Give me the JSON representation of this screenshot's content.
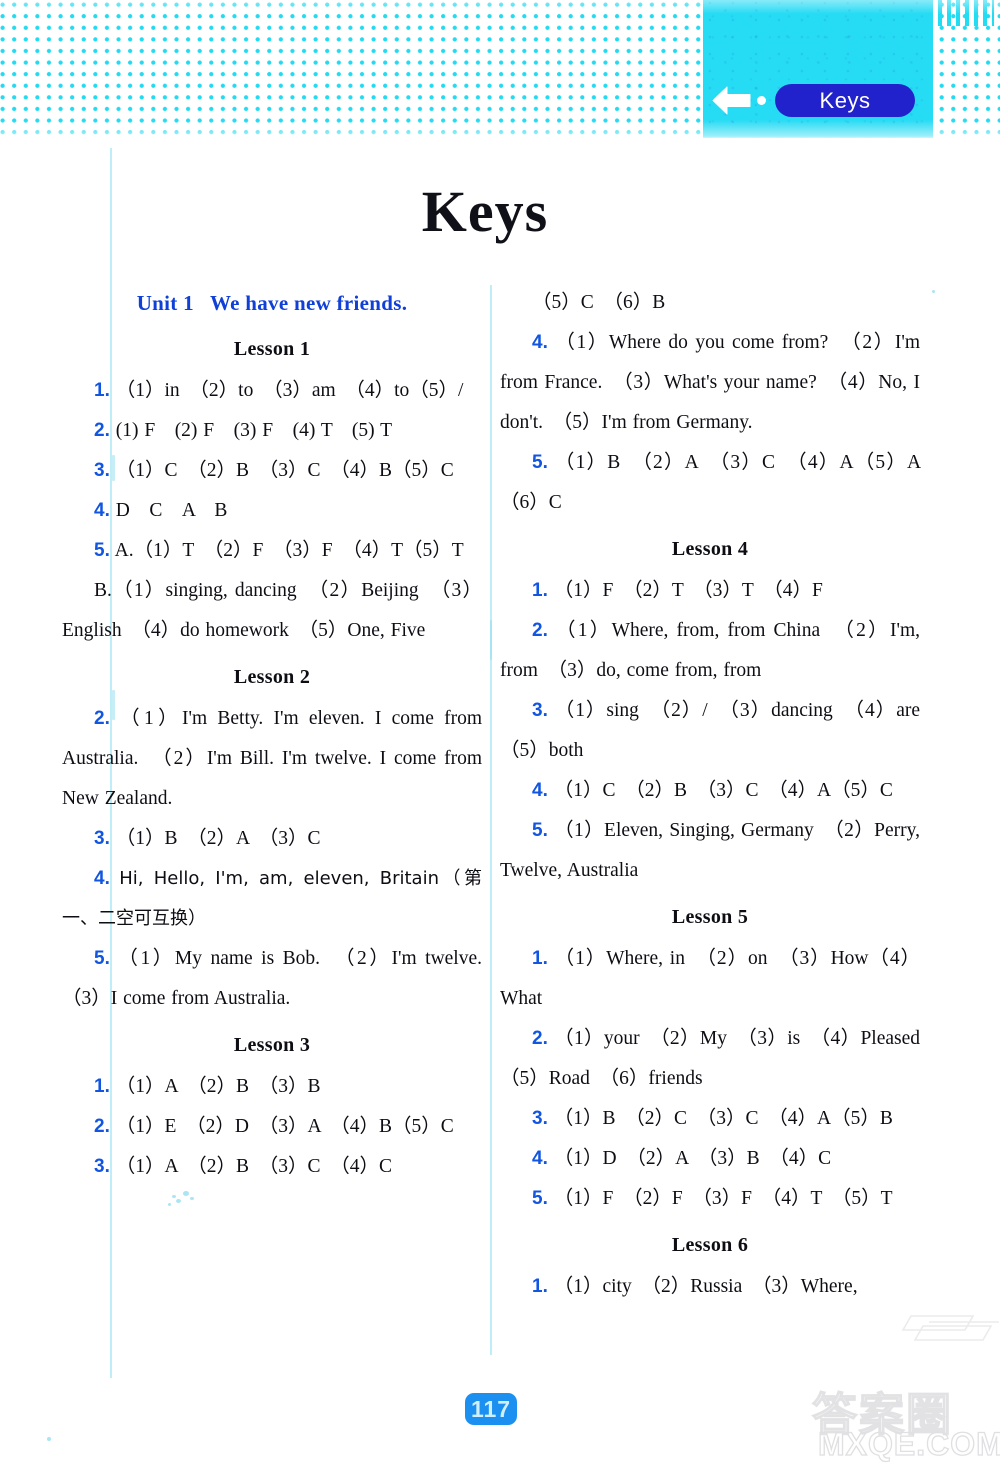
{
  "header": {
    "back_arrow_icon": "back-arrow-icon",
    "back_dot_icon": "dot-icon",
    "pill_label": "Keys",
    "pill_color": "#2222cc",
    "band_color": "#26dbf4"
  },
  "page_title": "Keys",
  "columns": {
    "left": [
      {
        "kind": "unit",
        "label": "Unit 1",
        "title": "We have new friends."
      },
      {
        "kind": "lesson",
        "label": "Lesson 1"
      },
      {
        "kind": "answer",
        "num": "1.",
        "text": "（1）in　（2）to　（3）am　（4）to（5）/"
      },
      {
        "kind": "answer",
        "num": "2.",
        "text": "(1) F　(2) F　(3) F　(4) T　(5) T"
      },
      {
        "kind": "answer",
        "num": "3.",
        "text": "（1）C　（2）B　（3）C　（4）B（5）C"
      },
      {
        "kind": "answer",
        "num": "4.",
        "text": "D　C　A　B"
      },
      {
        "kind": "answer",
        "num": "5.",
        "text": "A.（1）T　（2）F　（3）F　（4）T（5）T"
      },
      {
        "kind": "plain",
        "text": "B.（1）singing, dancing　（2）Beijing　（3）English　（4）do homework　（5）One, Five"
      },
      {
        "kind": "lesson",
        "label": "Lesson 2"
      },
      {
        "kind": "answer",
        "num": "2.",
        "text": "（1）I'm Betty. I'm eleven. I come from Australia.　（2）I'm Bill. I'm twelve. I come from New Zealand."
      },
      {
        "kind": "answer",
        "num": "3.",
        "text": "（1）B　（2）A　（3）C"
      },
      {
        "kind": "answer",
        "num": "4.",
        "text": "Hi, Hello, I'm, am, eleven, Britain（第一、二空可互换）"
      },
      {
        "kind": "answer",
        "num": "5.",
        "text": "（1）My name is Bob.　（2）I'm twelve.（3）I come from Australia."
      },
      {
        "kind": "lesson",
        "label": "Lesson 3"
      },
      {
        "kind": "answer",
        "num": "1.",
        "text": "（1）A　（2）B　（3）B"
      },
      {
        "kind": "answer",
        "num": "2.",
        "text": "（1）E　（2）D　（3）A　（4）B（5）C"
      },
      {
        "kind": "answer",
        "num": "3.",
        "text": "（1）A　（2）B　（3）C　（4）C"
      }
    ],
    "right": [
      {
        "kind": "plain",
        "text": "（5）C　（6）B"
      },
      {
        "kind": "answer",
        "num": "4.",
        "text": "（1）Where do you come from?　（2）I'm from France.　（3）What's your name?　（4）No, I don't.　（5）I'm from Germany."
      },
      {
        "kind": "answer",
        "num": "5.",
        "text": "（1）B　（2）A　（3）C　（4）A（5）A　（6）C"
      },
      {
        "kind": "lesson",
        "label": "Lesson 4"
      },
      {
        "kind": "answer",
        "num": "1.",
        "text": "（1）F　（2）T　（3）T　（4）F"
      },
      {
        "kind": "answer",
        "num": "2.",
        "text": "（1）Where, from, from China　（2）I'm, from　（3）do, come from, from"
      },
      {
        "kind": "answer",
        "num": "3.",
        "text": "（1）sing　（2）/　（3）dancing　（4）are　（5）both"
      },
      {
        "kind": "answer",
        "num": "4.",
        "text": "（1）C　（2）B　（3）C　（4）A（5）C"
      },
      {
        "kind": "answer",
        "num": "5.",
        "text": "（1）Eleven, Singing, Germany　（2）Perry, Twelve, Australia"
      },
      {
        "kind": "lesson",
        "label": "Lesson 5"
      },
      {
        "kind": "answer",
        "num": "1.",
        "text": "（1）Where, in　（2）on　（3）How（4）What"
      },
      {
        "kind": "answer",
        "num": "2.",
        "text": "（1）your　（2）My　（3）is　（4）Pleased　（5）Road　（6）friends"
      },
      {
        "kind": "answer",
        "num": "3.",
        "text": "（1）B　（2）C　（3）C　（4）A（5）B"
      },
      {
        "kind": "answer",
        "num": "4.",
        "text": "（1）D　（2）A　（3）B　（4）C"
      },
      {
        "kind": "answer",
        "num": "5.",
        "text": "（1）F　（2）F　（3）F　（4）T　（5）T"
      },
      {
        "kind": "lesson",
        "label": "Lesson 6"
      },
      {
        "kind": "answer",
        "num": "1.",
        "text": "（1）city　（2）Russia　（3）Where,"
      }
    ]
  },
  "footer": {
    "page_number": "117"
  },
  "watermark": {
    "cjk": "答案圈",
    "url": "MXQE.COM"
  }
}
